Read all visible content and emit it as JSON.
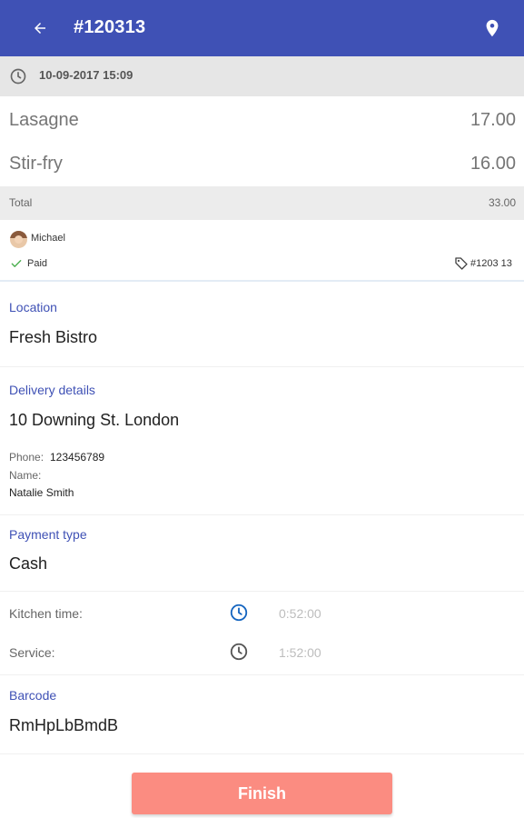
{
  "header": {
    "title": "#120313",
    "back_icon": "arrow-left-icon",
    "location_icon": "map-pin-icon",
    "color": "#3f51b5"
  },
  "date_bar": {
    "icon": "clock-icon",
    "datetime": "10-09-2017 15:09"
  },
  "order_items": [
    {
      "name": "Lasagne",
      "price": "17.00"
    },
    {
      "name": "Stir-fry",
      "price": "16.00"
    }
  ],
  "total": {
    "label": "Total",
    "value": "33.00"
  },
  "meta": {
    "user": "Michael",
    "status": "Paid",
    "order_tag": "#1203 13"
  },
  "location": {
    "label": "Location",
    "value": "Fresh Bistro"
  },
  "delivery": {
    "label": "Delivery details",
    "address": "10 Downing St. London",
    "phone_label": "Phone:",
    "phone": "123456789",
    "name_label": "Name:",
    "name": "Natalie Smith"
  },
  "payment": {
    "label": "Payment type",
    "value": "Cash"
  },
  "times": {
    "kitchen_label": "Kitchen time:",
    "kitchen_value": "0:52:00",
    "service_label": "Service:",
    "service_value": "1:52:00"
  },
  "barcode": {
    "label": "Barcode",
    "value": "RmHpLbBmdB"
  },
  "finish_button": {
    "label": "Finish",
    "color": "#fb8c81"
  }
}
